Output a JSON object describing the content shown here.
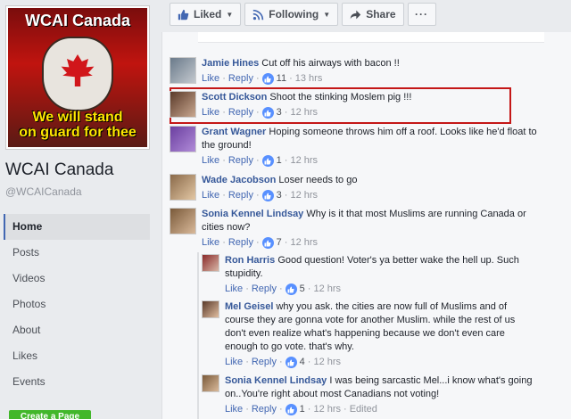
{
  "sidebar": {
    "profile_title": "WCAI Canada",
    "profile_slogan_line1": "We will stand",
    "profile_slogan_line2": "on guard for thee",
    "page_name": "WCAI Canada",
    "page_handle": "@WCAICanada",
    "nav": [
      "Home",
      "Posts",
      "Videos",
      "Photos",
      "About",
      "Likes",
      "Events"
    ],
    "create_page": "Create a Page"
  },
  "topbar": {
    "liked": "Liked",
    "following": "Following",
    "share": "Share",
    "more": "···"
  },
  "ui": {
    "like": "Like",
    "reply": "Reply",
    "sep": "·"
  },
  "comments": [
    {
      "name": "Jamie Hines",
      "text": "Cut off his airways with bacon !!",
      "reactions": "11",
      "time": "13 hrs"
    },
    {
      "name": "Scott Dickson",
      "text": "Shoot the stinking Moslem pig !!!",
      "reactions": "3",
      "time": "12 hrs"
    },
    {
      "name": "Grant Wagner",
      "text_line1": "Hoping someone throws him off a roof. Looks like he'd float to",
      "text_line2": "the ground!",
      "reactions": "1",
      "time": "12 hrs"
    },
    {
      "name": "Wade Jacobson",
      "text": "Loser needs to go",
      "reactions": "3",
      "time": "12 hrs"
    },
    {
      "name": "Sonia Kennel Lindsay",
      "text_line1": "Why is it that most Muslims are running Canada or",
      "text_line2": "cities now?",
      "reactions": "7",
      "time": "12 hrs"
    }
  ],
  "replies": [
    {
      "name": "Ron Harris",
      "text_line1": "Good question! Voter's ya better wake the hell up. Such",
      "text_line2": "stupidity.",
      "reactions": "5",
      "time": "12 hrs"
    },
    {
      "name": "Mel Geisel",
      "text_line1": "why you ask. the cities are now full of Muslims and of",
      "text_line2": "course they are gonna vote for another Muslim. while the rest of us",
      "text_line3": "don't even realize what's happening because we don't even care",
      "text_line4": "enough to go vote. that's why.",
      "reactions": "4",
      "time": "12 hrs"
    },
    {
      "name": "Sonia Kennel Lindsay",
      "text_line1": "I was being sarcastic Mel...i know what's going",
      "text_line2": "on..You're right about most Canadians not voting!",
      "reactions": "1",
      "time": "12 hrs",
      "edited": "Edited"
    }
  ],
  "colors": {
    "link": "#365899",
    "highlight": "#c41717",
    "reaction": "#5890ff",
    "active_nav": "#4267b2"
  }
}
